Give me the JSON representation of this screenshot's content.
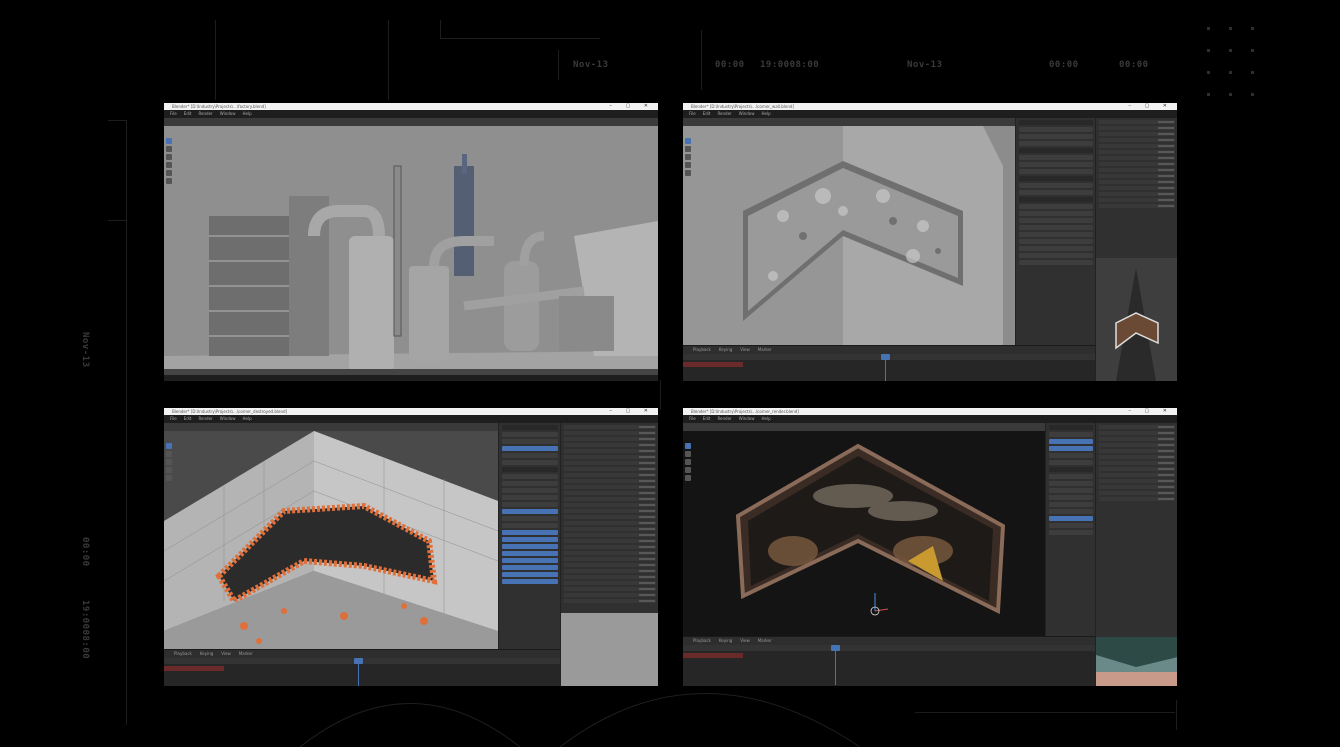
{
  "overlay": {
    "top_labels": [
      "Nov-13",
      "00:00",
      "19:0008:00",
      "Nov-13",
      "00:00",
      "00:00"
    ],
    "left_labels": [
      "Nov-13",
      "00:00",
      "19:0008:00"
    ]
  },
  "window_controls": "– ▢ ✕",
  "menus": [
    "File",
    "Edit",
    "Render",
    "Window",
    "Help"
  ],
  "timeline_menus": [
    "Playback",
    "Keying",
    "View",
    "Marker"
  ],
  "windows": [
    {
      "title": "Blender* [D:\\Industry\\Projects\\...\\factory.blend]",
      "scene": "factory"
    },
    {
      "title": "Blender* [D:\\Industry\\Projects\\...\\corner_wall.blend]",
      "scene": "corner-wall"
    },
    {
      "title": "Blender* [D:\\Industry\\Projects\\...\\corner_destroyed.blend]",
      "scene": "destroyed-corner"
    },
    {
      "title": "Blender* [D:\\Industry\\Projects\\...\\corner_render.blend]",
      "scene": "rendered-corner"
    }
  ],
  "colors": {
    "accent": "#4772b3",
    "debris": "#e0703a",
    "background": "#000000"
  }
}
